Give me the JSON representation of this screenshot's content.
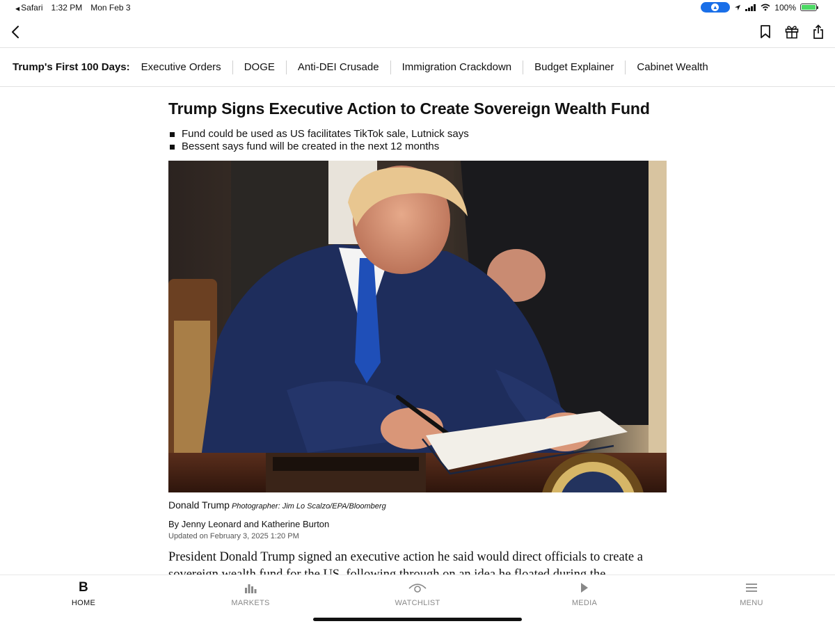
{
  "status_bar": {
    "back_app": "Safari",
    "time": "1:32 PM",
    "date": "Mon Feb 3",
    "battery": "100%"
  },
  "toolbar": {
    "back_icon": "chevron-left-icon",
    "bookmark_icon": "bookmark-icon",
    "gift_icon": "gift-icon",
    "share_icon": "share-icon"
  },
  "topic_bar": {
    "title": "Trump's First 100 Days:",
    "items": [
      "Executive Orders",
      "DOGE",
      "Anti-DEI Crusade",
      "Immigration Crackdown",
      "Budget Explainer",
      "Cabinet Wealth"
    ]
  },
  "article": {
    "headline": "Trump Signs Executive Action to Create Sovereign Wealth Fund",
    "bullets": [
      "Fund could be used as US facilitates TikTok sale, Lutnick says",
      "Bessent says fund will be created in the next 12 months"
    ],
    "caption": "Donald Trump",
    "photo_credit": "Photographer: Jim Lo Scalzo/EPA/Bloomberg",
    "byline": "By Jenny Leonard and Katherine Burton",
    "updated": "Updated on February 3, 2025 1:20 PM",
    "body_line1": "President Donald Trump signed an executive action he said would direct officials to create a",
    "body_line2": "sovereign wealth fund for the US, following through on an idea he floated during the"
  },
  "tabbar": {
    "tabs": [
      {
        "label": "HOME",
        "icon": "bloomberg-b-icon",
        "active": true
      },
      {
        "label": "MARKETS",
        "icon": "bar-chart-icon",
        "active": false
      },
      {
        "label": "WATCHLIST",
        "icon": "eye-icon",
        "active": false
      },
      {
        "label": "MEDIA",
        "icon": "play-icon",
        "active": false
      },
      {
        "label": "MENU",
        "icon": "menu-icon",
        "active": false
      }
    ]
  },
  "colors": {
    "accent": "#1a6fe8",
    "battery_fill": "#4cd964",
    "text": "#111111"
  }
}
